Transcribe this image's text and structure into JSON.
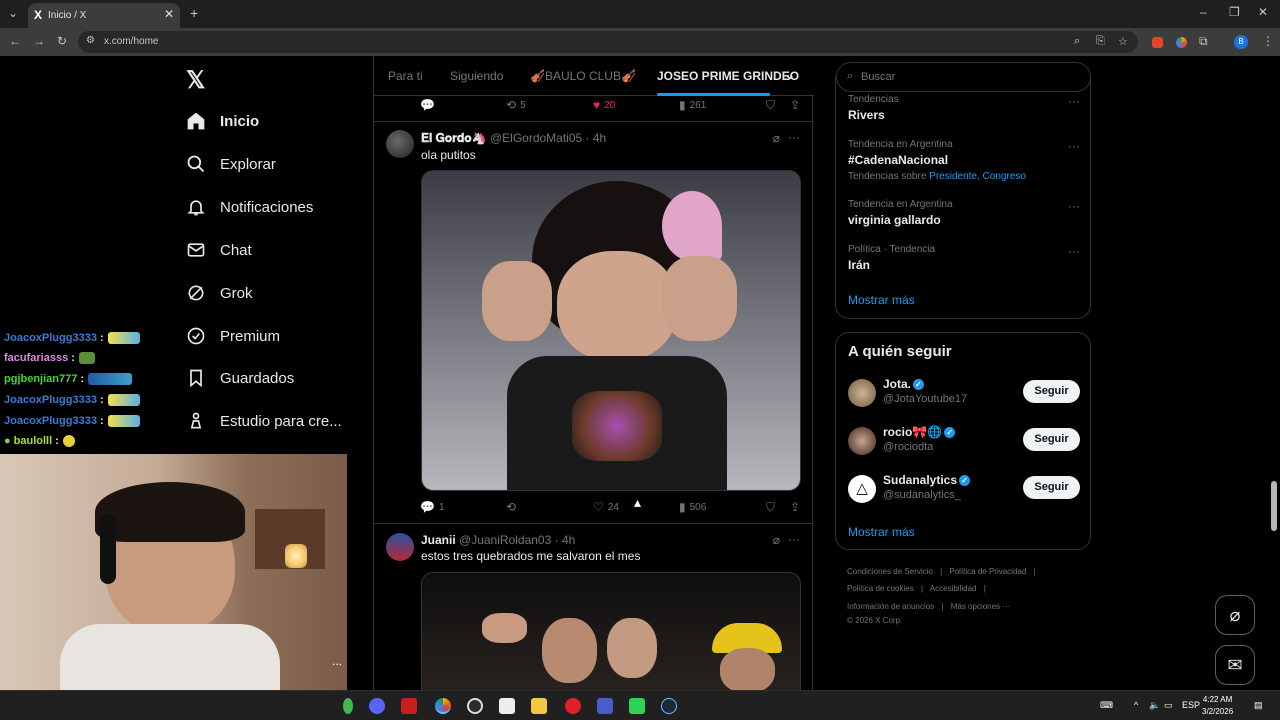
{
  "browser": {
    "tab_title": "Inicio / X",
    "tab_icon": "X",
    "url": "x.com/home"
  },
  "sidebar": {
    "logo": "𝕏",
    "items": [
      {
        "label": "Inicio",
        "icon": "home-icon"
      },
      {
        "label": "Explorar",
        "icon": "search-icon"
      },
      {
        "label": "Notificaciones",
        "icon": "bell-icon"
      },
      {
        "label": "Chat",
        "icon": "mail-icon"
      },
      {
        "label": "Grok",
        "icon": "grok-icon"
      },
      {
        "label": "Premium",
        "icon": "verified-icon"
      },
      {
        "label": "Guardados",
        "icon": "bookmark-icon"
      },
      {
        "label": "Estudio para cre...",
        "icon": "creator-studio-icon"
      }
    ]
  },
  "stream_chat": {
    "lines": [
      {
        "user": "JoacoxPlugg3333",
        "sep": ":",
        "color": "#3a7bd5"
      },
      {
        "user": "facufariasss",
        "sep": ":",
        "color": "#d88be0"
      },
      {
        "user": "pgjbenjian777",
        "sep": ":",
        "color": "#44d62c"
      },
      {
        "user": "JoacoxPlugg3333",
        "sep": ":",
        "color": "#3a7bd5"
      },
      {
        "user": "JoacoxPlugg3333",
        "sep": ":",
        "color": "#3a7bd5"
      },
      {
        "user": "baulolll",
        "sep": ":",
        "color": "#a6e22e"
      }
    ],
    "more": "..."
  },
  "feed": {
    "tabs": [
      "Para ti",
      "Siguiendo",
      "🎻BAULO CLUB🎻",
      "JOSEO PRIME GRINDEO"
    ],
    "prev_actions": {
      "replies": "",
      "reposts": "5",
      "likes": "20",
      "views": "261"
    },
    "tweets": [
      {
        "name": "𝐄𝐥 𝐆𝐨𝐫𝐝𝐨🦄",
        "handle": "@ElGordoMati05",
        "time": "· 4h",
        "text": "ola putitos",
        "replies": "1",
        "reposts": "",
        "likes": "24",
        "views": "506"
      },
      {
        "name": "Juanii",
        "handle": "@JuaniRoldan03",
        "time": "· 4h",
        "text": "estos tres quebrados me salvaron el mes"
      }
    ]
  },
  "right": {
    "search_placeholder": "Buscar",
    "trends": [
      {
        "category": "Tendencias",
        "name": "Rivers"
      },
      {
        "category": "Tendencia en Argentina",
        "name": "#CadenaNacional",
        "sub_prefix": "Tendencias sobre",
        "sub_links": [
          "Presidente",
          "Congreso"
        ]
      },
      {
        "category": "Tendencia en Argentina",
        "name": "virginia gallardo"
      },
      {
        "category": "Política · Tendencia",
        "name": "Irán"
      }
    ],
    "trends_show_more": "Mostrar más",
    "who_title": "A quién seguir",
    "who": [
      {
        "name": "Jota.",
        "handle": "@JotaYoutube17",
        "button": "Seguir"
      },
      {
        "name": "rocio🎀🌐",
        "handle": "@rociodta",
        "button": "Seguir"
      },
      {
        "name": "Sudanalytics",
        "handle": "@sudanalytics_",
        "button": "Seguir"
      }
    ],
    "who_show_more": "Mostrar más",
    "footer_lines": [
      [
        "Condiciones de Servicio",
        "Política de Privacidad"
      ],
      [
        "Política de cookies",
        "Accesibilidad"
      ],
      [
        "Información de anuncios",
        "Más opciones ···"
      ],
      [
        "© 2026 X Corp."
      ]
    ]
  },
  "taskbar": {
    "lang": "ESP",
    "time": "4:22 AM",
    "date": "3/2/2026"
  },
  "colors": {
    "accent": "#1d9bf0",
    "like": "#f91880"
  }
}
